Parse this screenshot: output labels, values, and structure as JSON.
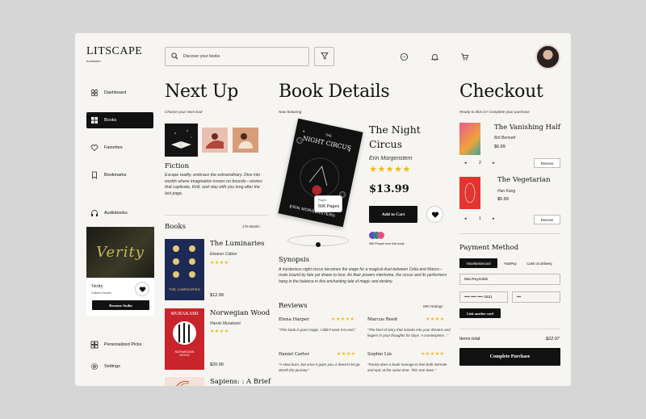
{
  "brand": {
    "name": "LITSCAPE",
    "tagline": "bookstore."
  },
  "search": {
    "placeholder": "Discover your books"
  },
  "nav": [
    {
      "label": "Dashboard",
      "icon": "dashboard-icon"
    },
    {
      "label": "Books",
      "icon": "books-icon",
      "active": true
    },
    {
      "label": "Favorites",
      "icon": "heart-icon"
    },
    {
      "label": "Bookmarks",
      "icon": "bookmark-icon"
    },
    {
      "label": "Audiobooks",
      "icon": "headphones-icon"
    },
    {
      "label": "Personalized Picks",
      "icon": "picks-icon"
    },
    {
      "label": "Settings",
      "icon": "gear-icon"
    }
  ],
  "audio_card": {
    "cover_text": "Verity",
    "title": "Verity",
    "author": "Colleen Hoover",
    "button": "Resume Audio"
  },
  "next_up": {
    "title": "Next Up",
    "subtitle": "Choose your next read",
    "genre": "Fiction",
    "genre_desc": "Escape reality, embrace the extraordinary. Dive into worlds where imagination knows no bounds—stories that captivate, thrill, and stay with you long after the last page.",
    "books_label": "Books",
    "books_count": "176 Books",
    "books": [
      {
        "title": "The Luminaries",
        "author": "Eleanor Catton",
        "stars": "★★★★",
        "price": "$12.99",
        "cover_text": "THE LUMINARIES"
      },
      {
        "title": "Norwegian Wood",
        "author": "Haruki Murakami",
        "stars": "★★★★",
        "price": "$20.00",
        "cover_top": "MURAKAMI",
        "cover_text": "NORWEGIAN WOOD"
      },
      {
        "title": "Sapiens: : A Brief"
      }
    ]
  },
  "details": {
    "title": "Book Details",
    "subtitle": "Now featuring",
    "book_title_line1": "The Night",
    "book_title_line2": "Circus",
    "author": "Erin Morgenstern",
    "stars": "★★★★★",
    "price": "$13.99",
    "add_to_cart": "Add to Cart",
    "pages_label": "Pages",
    "pages_value": "506 Pages",
    "cover_line1": "THE",
    "cover_line2": "NIGHT CIRCUS",
    "cover_author": "ERIN MORGENSTERN",
    "loved_by": "350 People love this book",
    "synopsis_title": "Synopsis",
    "synopsis": "A mysterious night circus becomes the stage for a magical duel between Celia and Marco—rivals bound by fate yet drawn to love. As their powers intertwine, the circus and its performers hang in the balance in this enchanting tale of magic and destiny.",
    "reviews_title": "Reviews",
    "reviews_count": "890 Ratings",
    "reviews": [
      {
        "name": "Elena Harper",
        "stars": "★★★★★",
        "text": "\"This book is pure magic. I didn't want it to end.\""
      },
      {
        "name": "Marcus Reed",
        "stars": "★★★★",
        "text": "\"The kind of story that sneaks into your dreams and lingers in your thoughts for days. A masterpiece...\""
      },
      {
        "name": "Daniel Carter",
        "stars": "★★★★",
        "text": "\"A slow burn, but once it grips you, it doesn't let go. Worth the journey.\""
      },
      {
        "name": "Sophie Lin",
        "stars": "★★★★★",
        "text": "\"Rarely does a book manage to feel both intimate and epic at the same time. This one does.\""
      }
    ]
  },
  "checkout": {
    "title": "Checkout",
    "subtitle": "Ready to dive in? Complete your purchase",
    "items": [
      {
        "title": "The Vanishing Half",
        "author": "Brit Bennett",
        "price": "$6.99",
        "qty": "2",
        "remove": "Remove"
      },
      {
        "title": "The Vegetarian",
        "author": "Han Kang",
        "price": "$5.99",
        "qty": "1",
        "remove": "Remove"
      }
    ],
    "payment_title": "Payment Method",
    "payment_tabs": [
      "Visa/Mastercard",
      "FastPay",
      "Cash on delivery"
    ],
    "card_name": "Mia Reynolds",
    "card_number": "•••• •••• •••• 4521",
    "card_cvv": "•••",
    "link_card": "Link another card",
    "items_total_label": "Items total",
    "items_total_value": "$22.97",
    "complete_button": "Complete Purchase"
  },
  "colors": {
    "accent": "#111111",
    "star": "#f2b90f",
    "panel": "#f6f5f1",
    "backdrop": "#d6d6d6"
  }
}
